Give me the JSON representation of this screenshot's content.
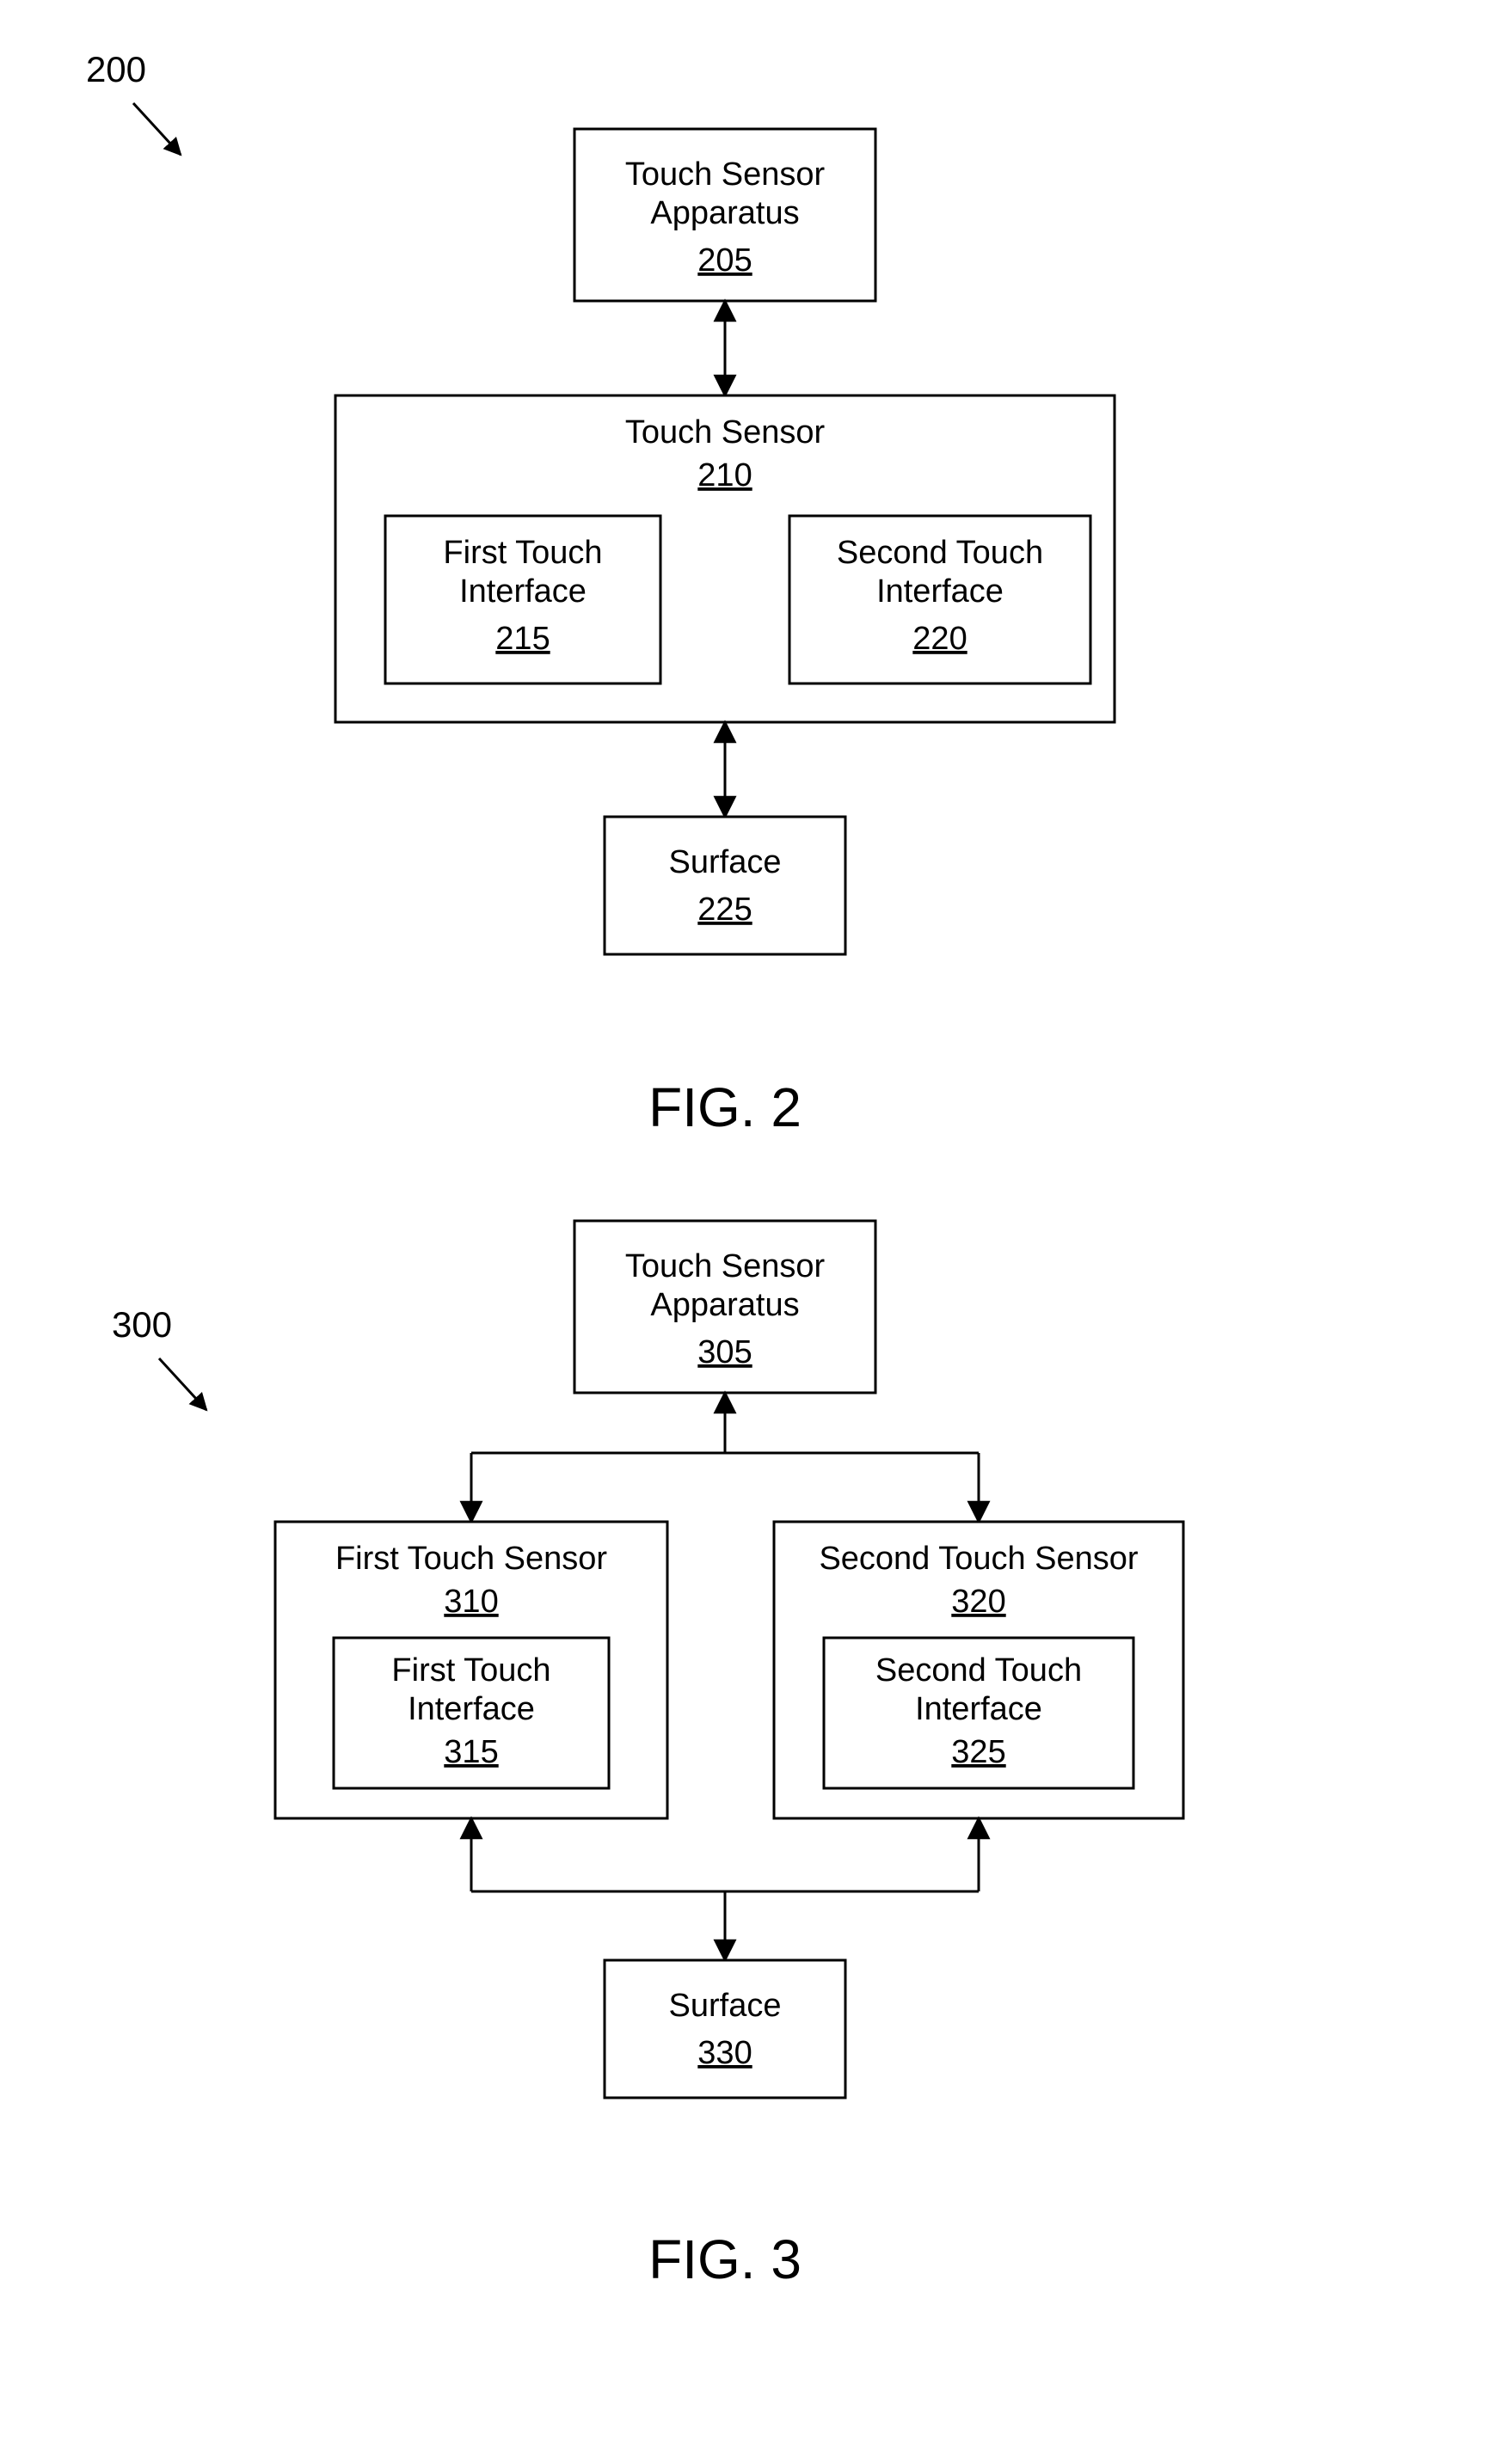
{
  "fig2": {
    "ref": "200",
    "caption": "FIG. 2",
    "apparatus": {
      "label": "Touch Sensor Apparatus",
      "num": "205"
    },
    "sensor": {
      "label": "Touch Sensor",
      "num": "210"
    },
    "iface1": {
      "label": "First Touch Interface",
      "num": "215"
    },
    "iface2": {
      "label": "Second Touch Interface",
      "num": "220"
    },
    "surface": {
      "label": "Surface",
      "num": "225"
    }
  },
  "fig3": {
    "ref": "300",
    "caption": "FIG. 3",
    "apparatus": {
      "label": "Touch Sensor Apparatus",
      "num": "305"
    },
    "sensor1": {
      "label": "First Touch Sensor",
      "num": "310"
    },
    "iface1": {
      "label": "First Touch Interface",
      "num": "315"
    },
    "sensor2": {
      "label": "Second Touch Sensor",
      "num": "320"
    },
    "iface2": {
      "label": "Second Touch Interface",
      "num": "325"
    },
    "surface": {
      "label": "Surface",
      "num": "330"
    }
  }
}
